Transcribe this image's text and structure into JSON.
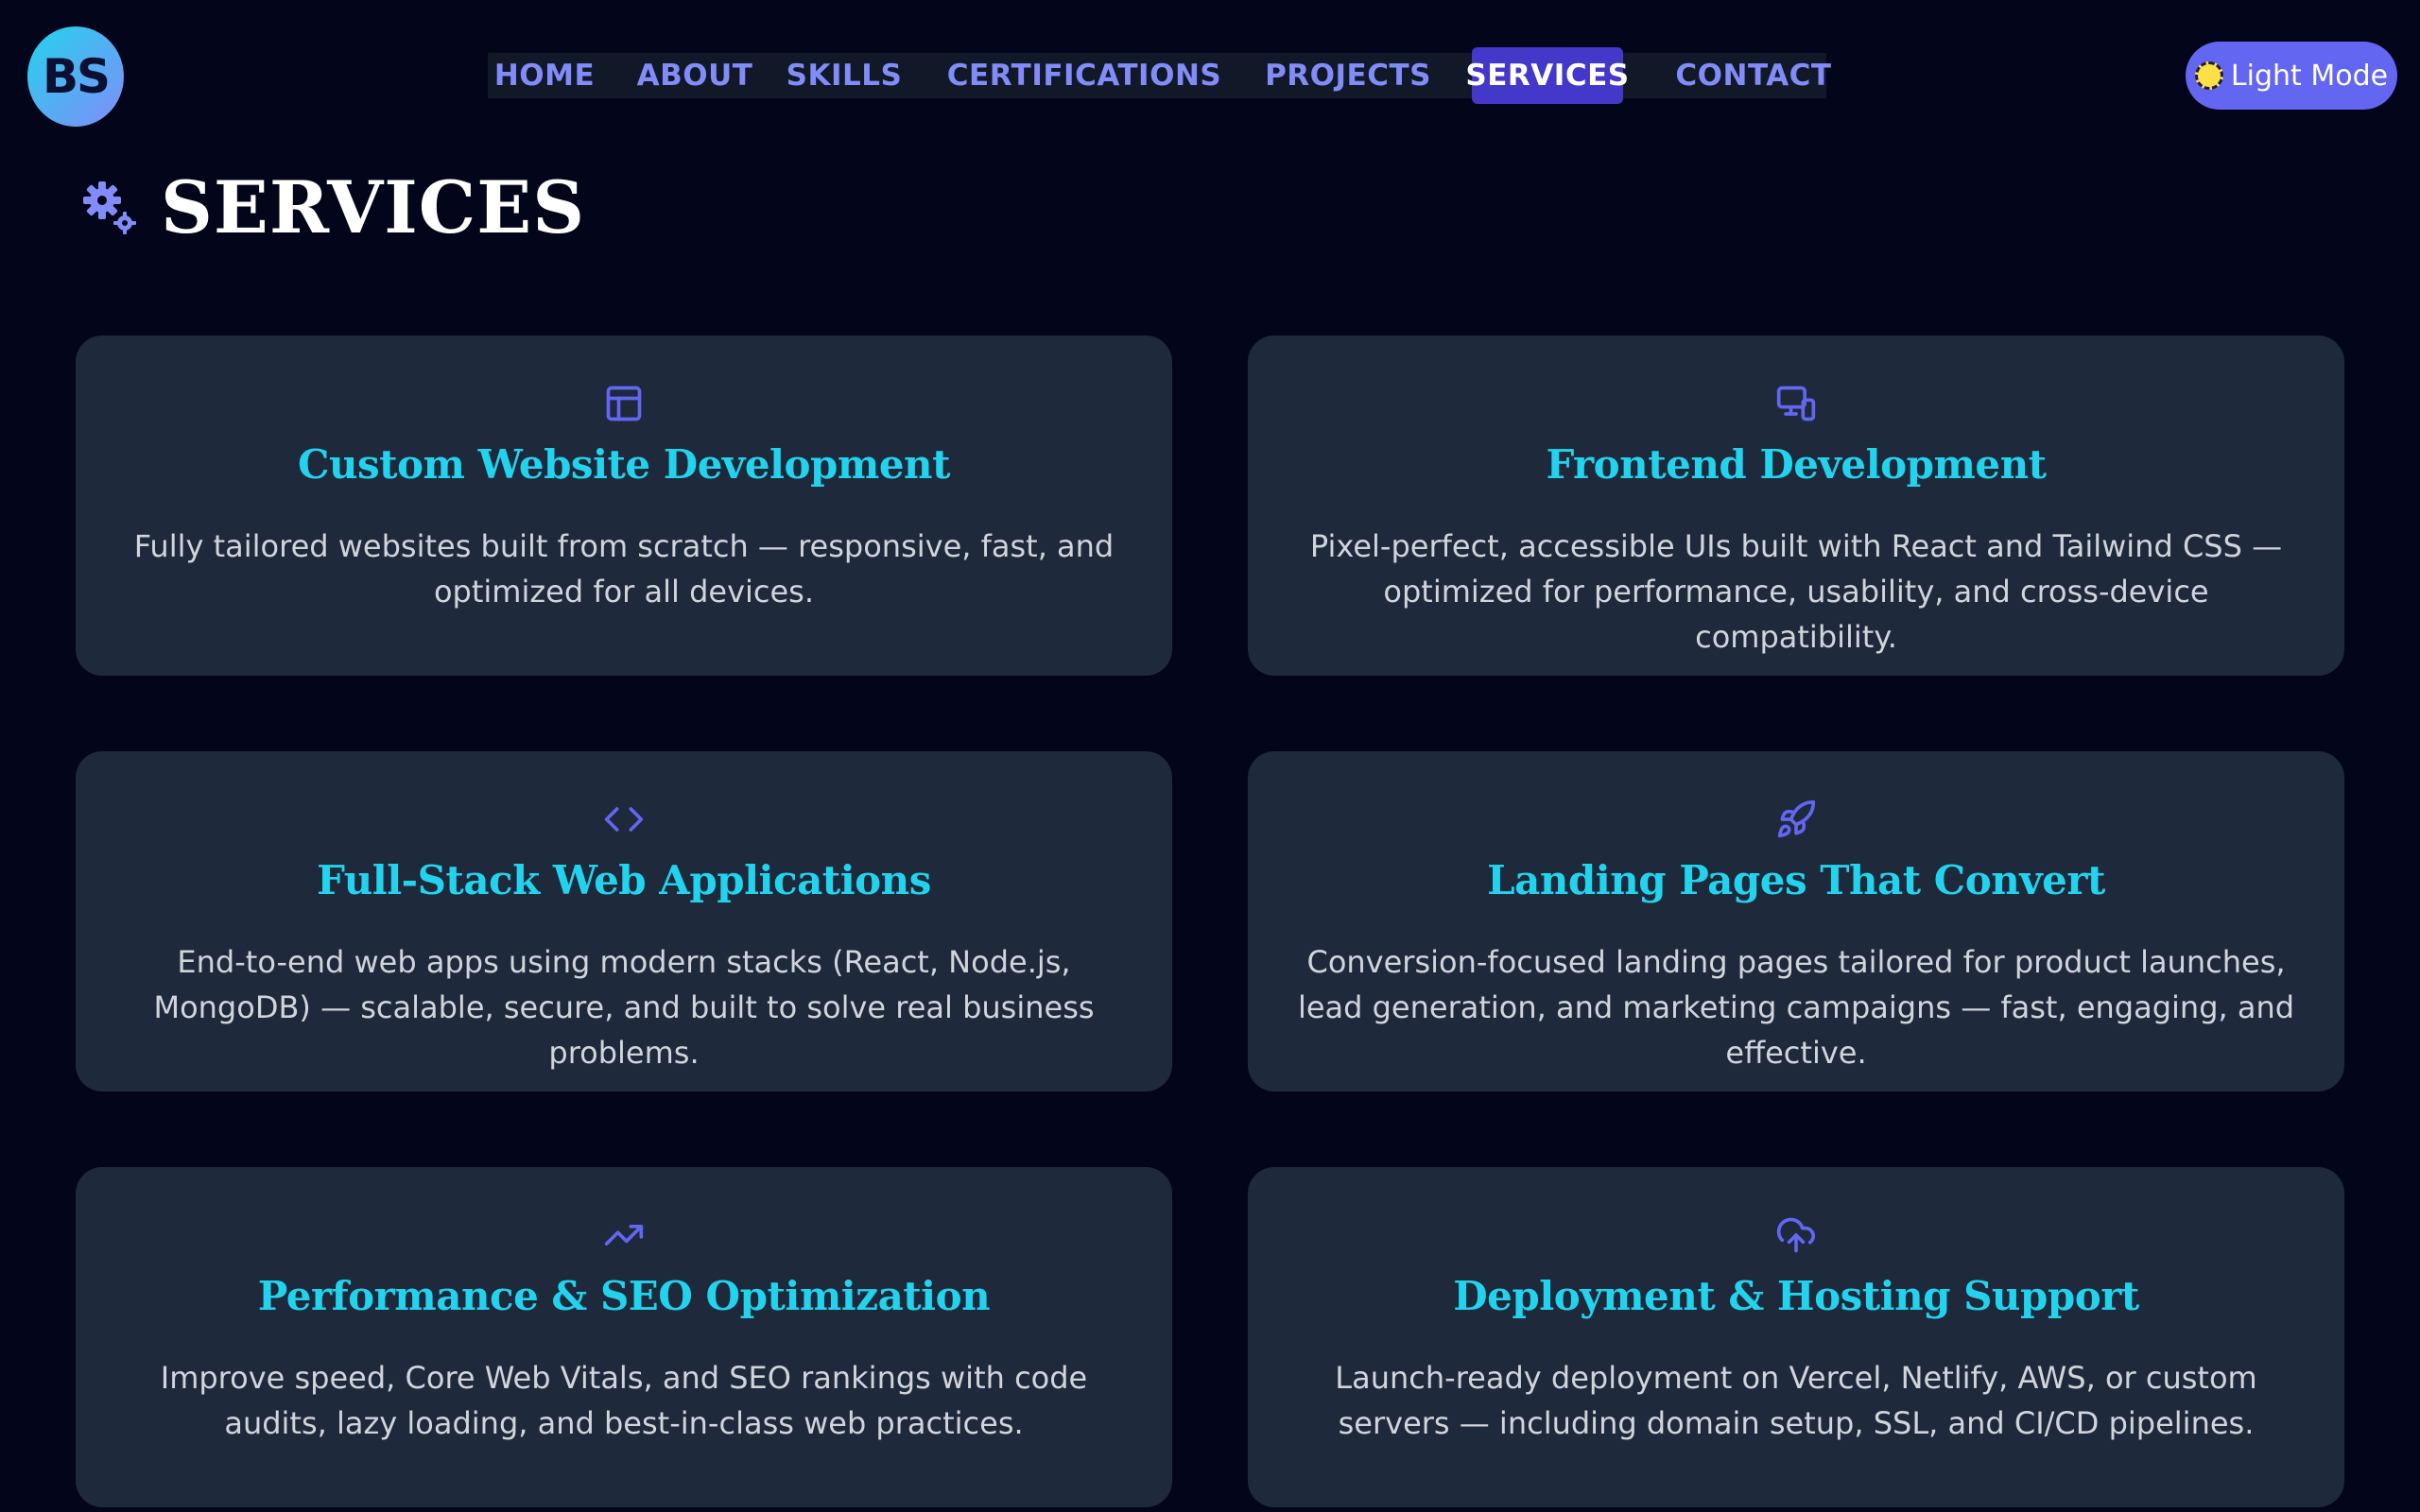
{
  "logo": {
    "text": "BS"
  },
  "nav": {
    "items": [
      {
        "label": "HOME"
      },
      {
        "label": "ABOUT"
      },
      {
        "label": "SKILLS"
      },
      {
        "label": "CERTIFICATIONS"
      },
      {
        "label": "PROJECTS"
      },
      {
        "label": "SERVICES",
        "active": true
      },
      {
        "label": "CONTACT"
      }
    ]
  },
  "mode_toggle": {
    "label": "Light Mode",
    "icon": "sun-icon"
  },
  "section": {
    "title": "SERVICES",
    "icon": "gears-icon"
  },
  "services": [
    {
      "icon": "layout-icon",
      "title": "Custom Website Development",
      "description": "Fully tailored websites built from scratch — responsive, fast, and optimized for all devices."
    },
    {
      "icon": "devices-icon",
      "title": "Frontend Development",
      "description": "Pixel-perfect, accessible UIs built with React and Tailwind CSS — optimized for performance, usability, and cross-device compatibility."
    },
    {
      "icon": "code-icon",
      "title": "Full-Stack Web Applications",
      "description": "End-to-end web apps using modern stacks (React, Node.js, MongoDB) — scalable, secure, and built to solve real business problems."
    },
    {
      "icon": "rocket-icon",
      "title": "Landing Pages That Convert",
      "description": "Conversion-focused landing pages tailored for product launches, lead generation, and marketing campaigns — fast, engaging, and effective."
    },
    {
      "icon": "trending-up-icon",
      "title": "Performance & SEO Optimization",
      "description": "Improve speed, Core Web Vitals, and SEO rankings with code audits, lazy loading, and best-in-class web practices."
    },
    {
      "icon": "cloud-upload-icon",
      "title": "Deployment & Hosting Support",
      "description": "Launch-ready deployment on Vercel, Netlify, AWS, or custom servers — including domain setup, SSL, and CI/CD pipelines."
    }
  ],
  "colors": {
    "background": "#03061a",
    "card": "#1e293b",
    "accent": "#22d3ee",
    "nav_text": "#818cf8",
    "active": "#4338ca",
    "button": "#6366f1"
  }
}
